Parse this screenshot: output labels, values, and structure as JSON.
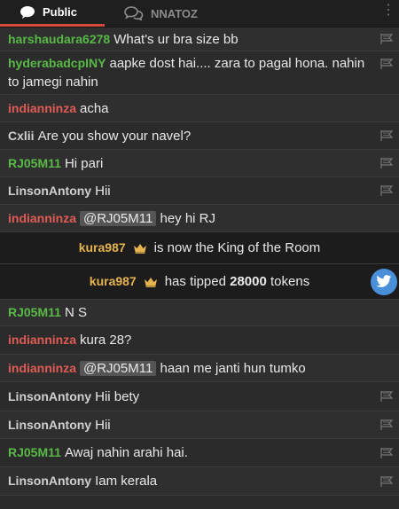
{
  "tabs": [
    {
      "label": "Public",
      "icon": "chat-bubble-icon",
      "active": true
    },
    {
      "label": "NNATOZ",
      "icon": "private-chat-icon",
      "active": false
    }
  ],
  "messages": [
    {
      "user": "harshaudara6278",
      "color": "green",
      "text": "What's ur bra size bb"
    },
    {
      "user": "hyderabadcpINY",
      "color": "green",
      "text": "aapke dost hai.... zara to pagal hona. nahin to jamegi nahin"
    },
    {
      "user": "indianninza",
      "color": "red",
      "text": "acha"
    },
    {
      "user": "Cxlii",
      "color": "gray",
      "text": "Are you show your navel?"
    },
    {
      "user": "RJ05M11",
      "color": "green",
      "text": "Hi pari"
    },
    {
      "user": "LinsonAntony",
      "color": "gray",
      "text": "Hii"
    },
    {
      "user": "indianninza",
      "color": "red",
      "mention": "@RJ05M11",
      "text": "hey hi RJ"
    },
    {
      "system": true,
      "user": "kura987",
      "text": "is now the King of the Room"
    },
    {
      "system": true,
      "user": "kura987",
      "text_before": "has tipped",
      "amount": "28000",
      "text_after": "tokens"
    },
    {
      "user": "RJ05M11",
      "color": "green",
      "text": "N S"
    },
    {
      "user": "indianninza",
      "color": "red",
      "text": "kura 28?"
    },
    {
      "user": "indianninza",
      "color": "red",
      "mention": "@RJ05M11",
      "text": "haan me janti hun tumko"
    },
    {
      "user": "LinsonAntony",
      "color": "gray",
      "text": "Hii bety"
    },
    {
      "user": "LinsonAntony",
      "color": "gray",
      "text": "Hii"
    },
    {
      "user": "RJ05M11",
      "color": "green",
      "text": "Awaj nahin arahi hai."
    },
    {
      "user": "LinsonAntony",
      "color": "gray",
      "text": "Iam kerala"
    }
  ]
}
